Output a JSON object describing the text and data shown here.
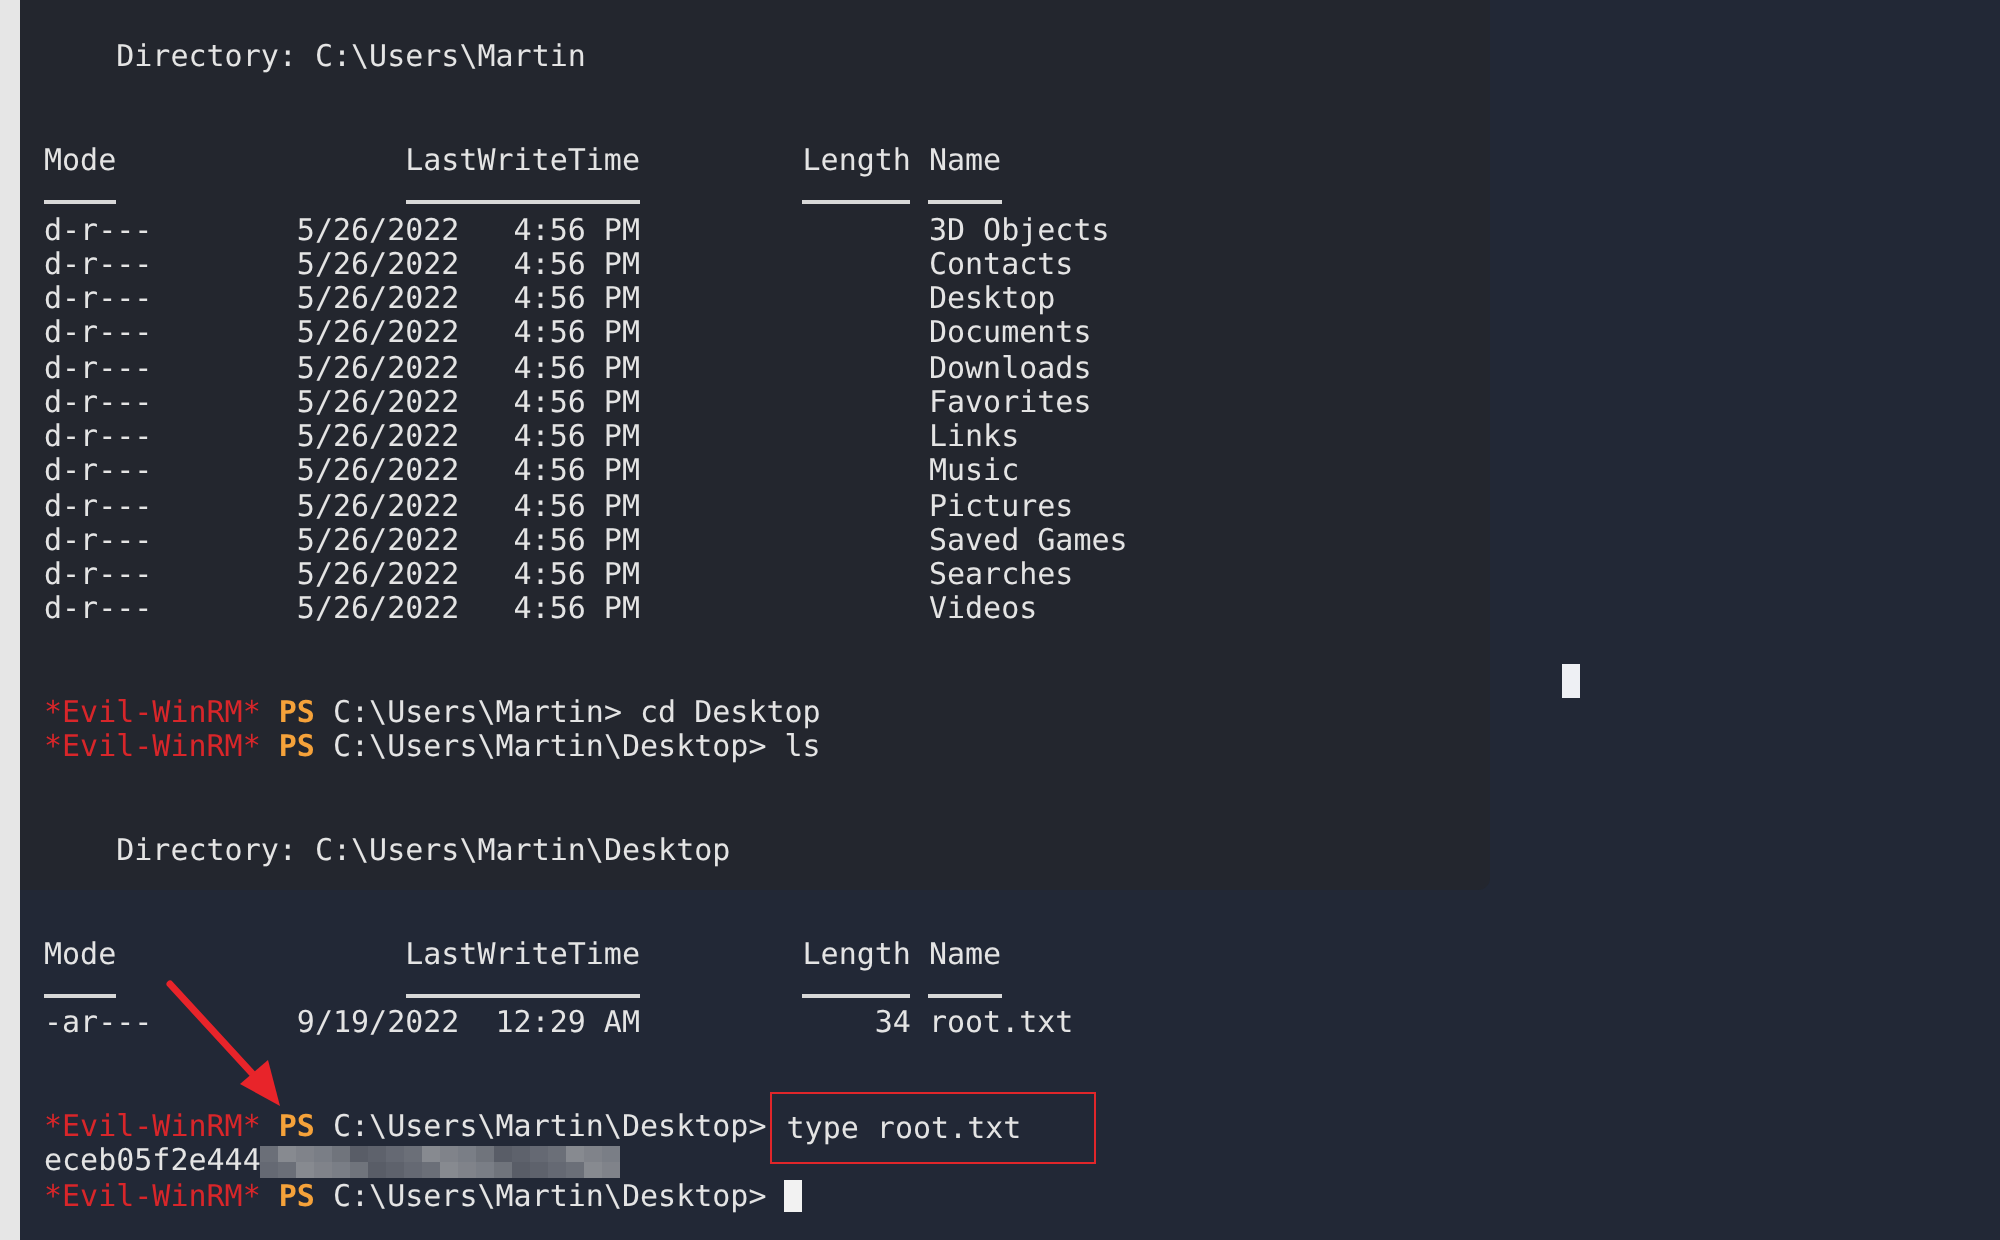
{
  "terminal": {
    "lines": [
      {
        "kind": "blank"
      },
      {
        "kind": "directory",
        "label": "Directory: C:\\Users\\Martin"
      },
      {
        "kind": "blank"
      },
      {
        "kind": "blank"
      },
      {
        "kind": "table_header",
        "columns": [
          "Mode",
          "LastWriteTime",
          "Length",
          "Name"
        ]
      },
      {
        "kind": "table_row",
        "mode": "d-r---",
        "date": "5/26/2022",
        "time": "4:56 PM",
        "name": "3D Objects"
      },
      {
        "kind": "table_row",
        "mode": "d-r---",
        "date": "5/26/2022",
        "time": "4:56 PM",
        "name": "Contacts"
      },
      {
        "kind": "table_row",
        "mode": "d-r---",
        "date": "5/26/2022",
        "time": "4:56 PM",
        "name": "Desktop"
      },
      {
        "kind": "table_row",
        "mode": "d-r---",
        "date": "5/26/2022",
        "time": "4:56 PM",
        "name": "Documents"
      },
      {
        "kind": "table_row",
        "mode": "d-r---",
        "date": "5/26/2022",
        "time": "4:56 PM",
        "name": "Downloads"
      },
      {
        "kind": "table_row",
        "mode": "d-r---",
        "date": "5/26/2022",
        "time": "4:56 PM",
        "name": "Favorites"
      },
      {
        "kind": "table_row",
        "mode": "d-r---",
        "date": "5/26/2022",
        "time": "4:56 PM",
        "name": "Links"
      },
      {
        "kind": "table_row",
        "mode": "d-r---",
        "date": "5/26/2022",
        "time": "4:56 PM",
        "name": "Music"
      },
      {
        "kind": "table_row",
        "mode": "d-r---",
        "date": "5/26/2022",
        "time": "4:56 PM",
        "name": "Pictures"
      },
      {
        "kind": "table_row",
        "mode": "d-r---",
        "date": "5/26/2022",
        "time": "4:56 PM",
        "name": "Saved Games"
      },
      {
        "kind": "table_row",
        "mode": "d-r---",
        "date": "5/26/2022",
        "time": "4:56 PM",
        "name": "Searches"
      },
      {
        "kind": "table_row",
        "mode": "d-r---",
        "date": "5/26/2022",
        "time": "4:56 PM",
        "name": "Videos"
      },
      {
        "kind": "blank"
      },
      {
        "kind": "blank"
      },
      {
        "kind": "prompt",
        "prefix": "*Evil-WinRM*",
        "shell": "PS",
        "path": "C:\\Users\\Martin>",
        "command": "cd Desktop",
        "highlighted": false,
        "cursor": false
      },
      {
        "kind": "prompt",
        "prefix": "*Evil-WinRM*",
        "shell": "PS",
        "path": "C:\\Users\\Martin\\Desktop>",
        "command": "ls",
        "highlighted": false,
        "cursor": false
      },
      {
        "kind": "blank"
      },
      {
        "kind": "blank"
      },
      {
        "kind": "directory",
        "label": "Directory: C:\\Users\\Martin\\Desktop"
      },
      {
        "kind": "blank"
      },
      {
        "kind": "blank"
      },
      {
        "kind": "table_header",
        "columns": [
          "Mode",
          "LastWriteTime",
          "Length",
          "Name"
        ]
      },
      {
        "kind": "table_row",
        "mode": "-ar---",
        "date": "9/19/2022",
        "time": "12:29 AM",
        "length": "34",
        "name": "root.txt"
      },
      {
        "kind": "blank"
      },
      {
        "kind": "blank"
      },
      {
        "kind": "prompt",
        "prefix": "*Evil-WinRM*",
        "shell": "PS",
        "path": "C:\\Users\\Martin\\Desktop>",
        "command": "type root.txt",
        "highlighted": true,
        "cursor": false
      },
      {
        "kind": "output",
        "text": "eceb05f2e444",
        "redacted": true
      },
      {
        "kind": "prompt",
        "prefix": "*Evil-WinRM*",
        "shell": "PS",
        "path": "C:\\Users\\Martin\\Desktop>",
        "highlighted": false,
        "cursor": true
      }
    ]
  }
}
